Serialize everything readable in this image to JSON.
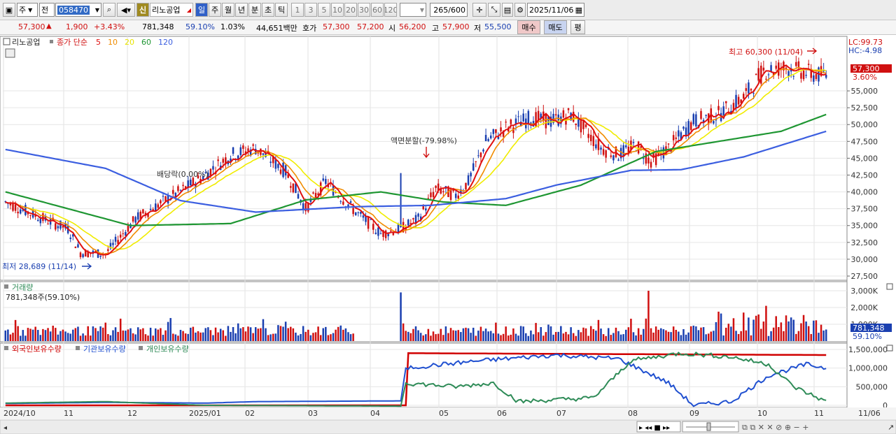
{
  "toolbar": {
    "market": "주",
    "period_type": "전",
    "stock_code": "058470",
    "badge": "신",
    "stock_name": "리노공업",
    "period_tabs": [
      "일",
      "주",
      "월",
      "년",
      "분",
      "초",
      "틱"
    ],
    "active_tab": "일",
    "intervals": [
      "1",
      "3",
      "5",
      "10",
      "20",
      "30",
      "60",
      "120"
    ],
    "count_current": "265",
    "count_total": "/600",
    "date": "2025/11/06"
  },
  "quote": {
    "price": "57,300",
    "change": "1,900",
    "change_pct": "+3.43%",
    "volume": "781,348",
    "turnover_pct": "59.10%",
    "vol_ratio": "1.03%",
    "amount": "44,651백만",
    "ask_label": "호가",
    "ask": "57,300",
    "bid": "57,200",
    "open_label": "시",
    "open": "56,200",
    "high_label": "고",
    "high": "57,900",
    "low_label": "저",
    "low": "55,500",
    "buy_label": "매수",
    "sell_label": "매도",
    "eval_label": "평"
  },
  "price_panel": {
    "stock_label": "리노공업",
    "legend_prefix": "종가 단순",
    "ma_periods": [
      {
        "label": "5",
        "color": "#e01010"
      },
      {
        "label": "10",
        "color": "#f08c00"
      },
      {
        "label": "20",
        "color": "#e8e400"
      },
      {
        "label": "60",
        "color": "#1e9632"
      },
      {
        "label": "120",
        "color": "#3b5ee0"
      }
    ],
    "lc": "LC:99.73",
    "hc": "HC:-4.98",
    "current_tag": "57,300",
    "current_pct": "3.60%",
    "annotation_high": "최고 60,300 (11/04)",
    "annotation_low": "최저 28,689 (11/14)",
    "annotation_dividend": "배당락(0.00%)",
    "annotation_split": "액면분할(-79.98%)",
    "y_ticks": [
      "55,000",
      "52,500",
      "50,000",
      "47,500",
      "45,000",
      "42,500",
      "40,000",
      "37,500",
      "35,000",
      "32,500",
      "30,000",
      "27,500"
    ]
  },
  "volume_panel": {
    "title": "거래량",
    "info": "781,348주(59.10%)",
    "y_ticks": [
      "3,000K",
      "2,000K",
      "1,000K"
    ],
    "current_tag": "781,348",
    "current_pct": "59.10%"
  },
  "holding_panel": {
    "legend": [
      {
        "label": "외국인보유수량",
        "color": "#d00000"
      },
      {
        "label": "기관보유수량",
        "color": "#2050d0"
      },
      {
        "label": "개인보유수량",
        "color": "#2e8b57"
      }
    ],
    "y_ticks": [
      "1,500,000",
      "1,000,000",
      "500,000",
      "0"
    ]
  },
  "x_axis": {
    "labels": [
      "2024/10",
      "11",
      "12",
      "2025/01",
      "02",
      "03",
      "04",
      "05",
      "06",
      "07",
      "08",
      "09",
      "10",
      "11",
      "11/06"
    ]
  },
  "chart_data": {
    "type": "line",
    "title": "리노공업",
    "price_ylim": [
      27500,
      60300
    ],
    "price_series": [
      {
        "name": "종가",
        "x": [
          "2024/10",
          "2024/11",
          "2024/12",
          "2025/01",
          "2025/02",
          "2025/03",
          "2025/04",
          "2025/05",
          "2025/06",
          "2025/07",
          "2025/08",
          "2025/09",
          "2025/10",
          "2025/11/06"
        ],
        "values": [
          38500,
          35500,
          30500,
          38500,
          45500,
          41500,
          36000,
          36000,
          42000,
          51500,
          46000,
          46000,
          54500,
          57300
        ]
      },
      {
        "name": "120",
        "values": [
          46300,
          43500,
          38700,
          37000,
          37600,
          38200,
          37900,
          38000,
          39500,
          43000,
          43300,
          44000,
          46000,
          49000
        ]
      },
      {
        "name": "60",
        "values": [
          40000,
          37000,
          35000,
          35000,
          36500,
          40000,
          41500,
          39000,
          38000,
          43000,
          47500,
          48500,
          49000,
          51500
        ]
      }
    ],
    "volume": {
      "name": "거래량",
      "max_tick": "3,000K",
      "current": 781348
    },
    "holdings": [
      {
        "name": "외국인보유수량",
        "values": [
          0,
          0,
          0,
          0,
          0,
          0,
          0,
          1400000,
          1380000,
          1370000,
          1380000,
          1370000,
          1370000,
          1350000
        ]
      },
      {
        "name": "기관보유수량",
        "values": [
          0,
          50000,
          80000,
          100000,
          100000,
          150000,
          150000,
          100000,
          1200000,
          1250000,
          1300000,
          900000,
          0,
          1000000
        ]
      },
      {
        "name": "개인보유수량",
        "values": [
          50000,
          60000,
          70000,
          30000,
          0,
          0,
          0,
          500000,
          100000,
          200000,
          1200000,
          1300000,
          1200000,
          100000
        ]
      }
    ]
  },
  "colors": {
    "up": "#d01010",
    "down": "#1a3fb0",
    "bg": "#ffffff",
    "grid": "#e6e6e6"
  }
}
